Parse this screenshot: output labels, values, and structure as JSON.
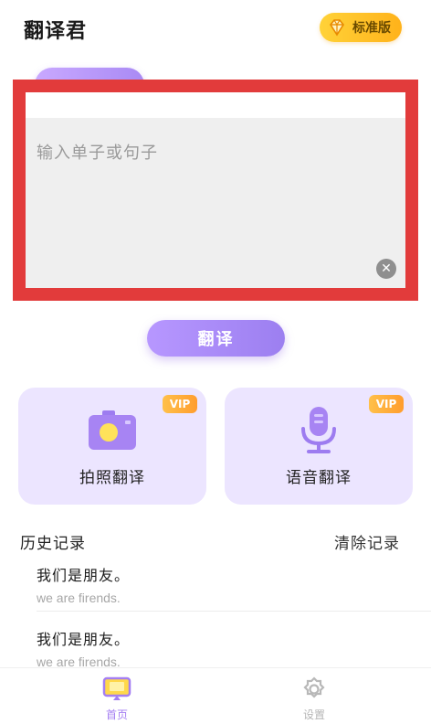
{
  "header": {
    "app_title": "翻译君",
    "edition_label": "标准版"
  },
  "input": {
    "placeholder": "输入单子或句子"
  },
  "translate_button": "翻译",
  "features": [
    {
      "label": "拍照翻译",
      "badge": "VIP",
      "icon": "camera-icon"
    },
    {
      "label": "语音翻译",
      "badge": "VIP",
      "icon": "microphone-icon"
    }
  ],
  "history": {
    "title": "历史记录",
    "clear_label": "清除记录",
    "items": [
      {
        "source": "我们是朋友。",
        "translation": "we are firends."
      },
      {
        "source": "我们是朋友。",
        "translation": "we are firends."
      }
    ]
  },
  "nav": {
    "items": [
      {
        "label": "首页",
        "icon": "home-screen-icon",
        "active": true
      },
      {
        "label": "设置",
        "icon": "gear-icon",
        "active": false
      }
    ]
  },
  "colors": {
    "accent": "#a47ef2",
    "annotation_frame": "#e23b3b",
    "vip": "#ffa530",
    "badge": "#ffc52a"
  }
}
